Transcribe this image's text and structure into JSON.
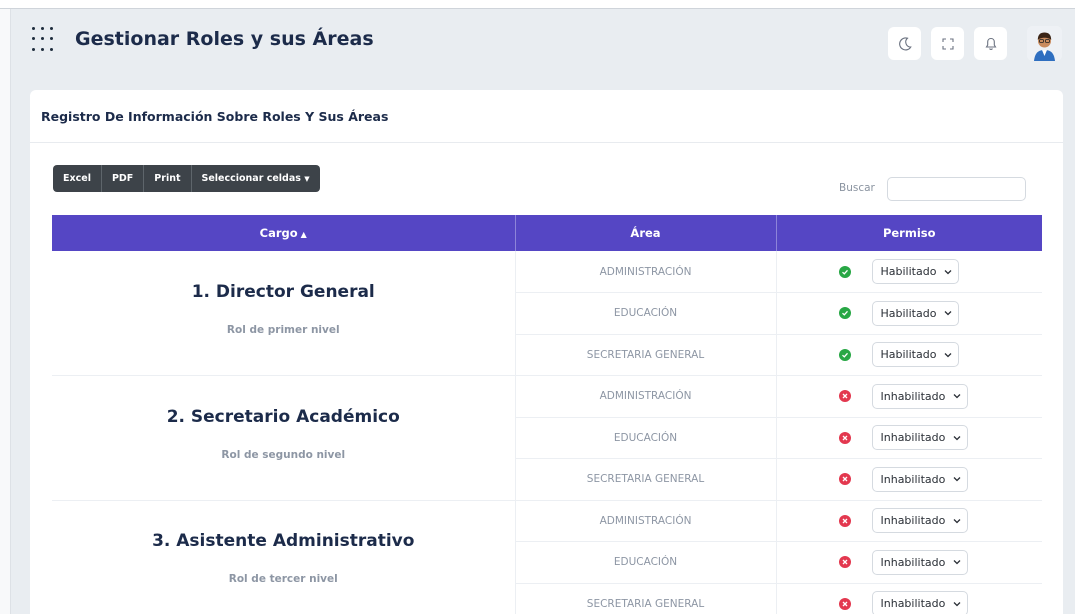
{
  "header": {
    "title": "Gestionar Roles y sus Áreas",
    "icons": [
      "apps-grid-icon",
      "moon-icon",
      "fullscreen-icon",
      "bell-icon",
      "avatar"
    ]
  },
  "card": {
    "title": "Registro De Información Sobre Roles Y Sus Áreas"
  },
  "toolbar": {
    "excel": "Excel",
    "pdf": "PDF",
    "print": "Print",
    "select_cells": "Seleccionar celdas"
  },
  "search": {
    "label": "Buscar",
    "value": ""
  },
  "table": {
    "headers": [
      "Cargo",
      "Área",
      "Permiso"
    ],
    "roles": [
      {
        "name": "1. Director General",
        "level": "Rol de primer nivel",
        "rows": [
          {
            "area": "ADMINISTRACIÓN",
            "permiso": "Habilitado",
            "status": "ok"
          },
          {
            "area": "EDUCACIÓN",
            "permiso": "Habilitado",
            "status": "ok"
          },
          {
            "area": "SECRETARIA GENERAL",
            "permiso": "Habilitado",
            "status": "ok"
          }
        ]
      },
      {
        "name": "2. Secretario Académico",
        "level": "Rol de segundo nivel",
        "rows": [
          {
            "area": "ADMINISTRACIÓN",
            "permiso": "Inhabilitado",
            "status": "off"
          },
          {
            "area": "EDUCACIÓN",
            "permiso": "Inhabilitado",
            "status": "off"
          },
          {
            "area": "SECRETARIA GENERAL",
            "permiso": "Inhabilitado",
            "status": "off"
          }
        ]
      },
      {
        "name": "3. Asistente Administrativo",
        "level": "Rol de tercer nivel",
        "rows": [
          {
            "area": "ADMINISTRACIÓN",
            "permiso": "Inhabilitado",
            "status": "off"
          },
          {
            "area": "EDUCACIÓN",
            "permiso": "Inhabilitado",
            "status": "off"
          },
          {
            "area": "SECRETARIA GENERAL",
            "permiso": "Inhabilitado",
            "status": "off"
          }
        ]
      }
    ]
  },
  "colors": {
    "accent": "#5546c4",
    "ok": "#28a745",
    "off": "#e3384f",
    "title": "#1c2b4a"
  }
}
